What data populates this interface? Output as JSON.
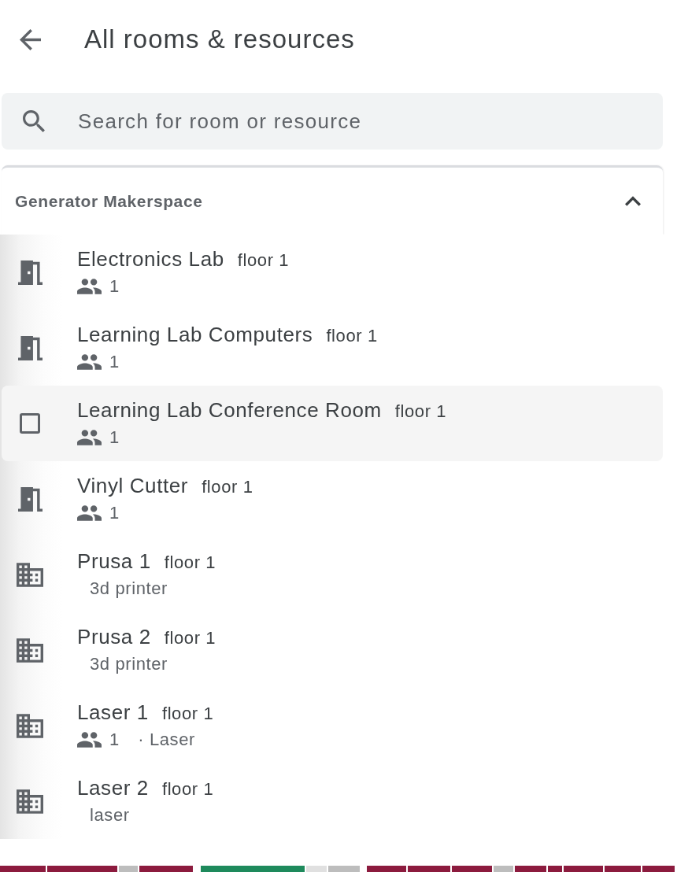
{
  "header": {
    "title": "All rooms & resources"
  },
  "search": {
    "placeholder": "Search for room or resource"
  },
  "section": {
    "title": "Generator Makerspace",
    "expanded": true,
    "items": [
      {
        "name": "Electronics Lab",
        "floor": "floor 1",
        "kind": "room",
        "hovered": false,
        "capacity": "1"
      },
      {
        "name": "Learning Lab Computers",
        "floor": "floor 1",
        "kind": "room",
        "hovered": false,
        "capacity": "1"
      },
      {
        "name": "Learning Lab Conference Room",
        "floor": "floor 1",
        "hovered": true,
        "capacity": "1"
      },
      {
        "name": "Vinyl Cutter",
        "floor": "floor 1",
        "kind": "room",
        "hovered": false,
        "capacity": "1"
      },
      {
        "name": "Prusa 1",
        "floor": "floor 1",
        "kind": "resource",
        "hovered": false,
        "description": "3d printer"
      },
      {
        "name": "Prusa 2",
        "floor": "floor 1",
        "kind": "resource",
        "hovered": false,
        "description": "3d printer"
      },
      {
        "name": "Laser 1",
        "floor": "floor 1",
        "kind": "resource",
        "hovered": false,
        "capacity": "1",
        "description": "· Laser"
      },
      {
        "name": "Laser 2",
        "floor": "floor 1",
        "kind": "resource",
        "hovered": false,
        "description": "laser"
      }
    ]
  },
  "calendar_strip": [
    {
      "color": "#8c1b3e"
    },
    {
      "color": "#8c1b3e"
    },
    {
      "color": "#bdbdbd"
    },
    {
      "color": "#8c1b3e"
    },
    {
      "color": "#1e8a5c"
    },
    {
      "color": "#e0e0e0"
    },
    {
      "color": "#bdbdbd"
    },
    {
      "color": "#8c1b3e"
    },
    {
      "color": "#8c1b3e"
    },
    {
      "color": "#8c1b3e"
    },
    {
      "color": "#bdbdbd"
    },
    {
      "color": "#8c1b3e"
    },
    {
      "color": "#8c1b3e"
    },
    {
      "color": "#8c1b3e"
    },
    {
      "color": "#8c1b3e"
    },
    {
      "color": "#8c1b3e"
    }
  ]
}
